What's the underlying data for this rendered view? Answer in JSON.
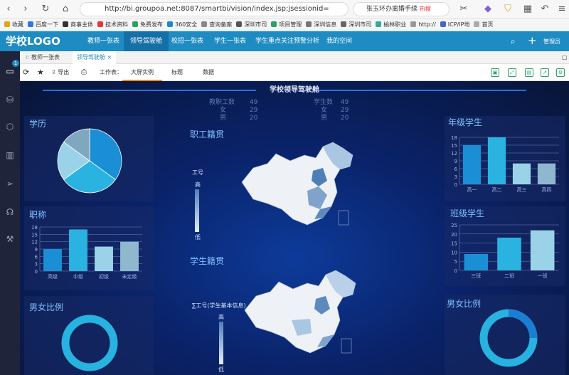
{
  "browser": {
    "url": "http://bi.groupoa.net:8087/smartbi/vision/index.jsp;jsessionid=",
    "search": "张玉环办离婚手续",
    "hot": "热搜",
    "bookmarks": [
      "收藏",
      "百度一下",
      "商事主体",
      "技术资料",
      "免费发布",
      "360安全",
      "查询备案",
      "深圳市司",
      "项目管理",
      "深圳信息",
      "深圳市司",
      "榆林职业",
      "http://",
      "ICP/IP地",
      "首页"
    ]
  },
  "app": {
    "logo": "学校LOGO",
    "menu": [
      "教师一张表",
      "领导驾驶舱",
      "校招一张表",
      "学生一张表",
      "学生重点关注预警分析",
      "我的空间"
    ],
    "active_menu": 1,
    "user": "管理员",
    "badge": "1"
  },
  "tabs": [
    "教师一张表",
    "领导驾驶舱"
  ],
  "toolbar": {
    "refresh": "",
    "export": "导出",
    "worksheet_label": "工作表：",
    "worksheets": [
      "大屏实例",
      "标题",
      "数据"
    ]
  },
  "dashboard": {
    "title": "学校领导驾驶舱",
    "stats": [
      {
        "label": "教职工数",
        "value": "49"
      },
      {
        "label": "女",
        "value": "29"
      },
      {
        "label": "男",
        "value": "20"
      }
    ],
    "stats2": [
      {
        "label": "学生数",
        "value": "49"
      },
      {
        "label": "女",
        "value": "29"
      },
      {
        "label": "男",
        "value": "20"
      }
    ],
    "panels": {
      "education": "学历",
      "title": "职称",
      "gender1": "男女比例",
      "staff_origin": "职工籍贯",
      "student_origin": "学生籍贯",
      "grade": "年级学生",
      "class": "班级学生",
      "gender2": "男女比例"
    },
    "map1_legend": {
      "name": "工号",
      "high": "高",
      "low": "低"
    },
    "map2_legend": {
      "name": "∑工号(学生基本信息)",
      "high": "高",
      "low": "低"
    }
  },
  "chart_data": [
    {
      "type": "pie",
      "title": "学历",
      "values": [
        35,
        30,
        20,
        15
      ],
      "colors": [
        "#1a8fd6",
        "#2ab3e0",
        "#9ad3e8",
        "#7ea8c0"
      ]
    },
    {
      "type": "bar",
      "title": "职称",
      "categories": [
        "高级",
        "中级",
        "初级",
        "未定级"
      ],
      "values": [
        9,
        17,
        10,
        12
      ],
      "ylim": [
        0,
        18
      ],
      "yticks": [
        0,
        3,
        6,
        9,
        12,
        15,
        18
      ],
      "colors": [
        "#1a8fd6",
        "#2ab3e0",
        "#9ad3e8",
        "#8fb8cf"
      ]
    },
    {
      "type": "bar",
      "title": "年级学生",
      "categories": [
        "高一",
        "高二",
        "高三",
        "高四"
      ],
      "values": [
        15,
        18,
        8,
        8
      ],
      "ylim": [
        0,
        18
      ],
      "yticks": [
        0,
        3,
        6,
        9,
        12,
        15,
        18
      ],
      "colors": [
        "#1a8fd6",
        "#2ab3e0",
        "#9ad3e8",
        "#8fb8cf"
      ]
    },
    {
      "type": "bar",
      "title": "班级学生",
      "categories": [
        "三班",
        "二班",
        "一班"
      ],
      "values": [
        9,
        18,
        22
      ],
      "ylim": [
        0,
        25
      ],
      "yticks": [
        0,
        5,
        10,
        15,
        20,
        25
      ],
      "colors": [
        "#1a8fd6",
        "#2ab3e0",
        "#9ad3e8"
      ]
    }
  ]
}
